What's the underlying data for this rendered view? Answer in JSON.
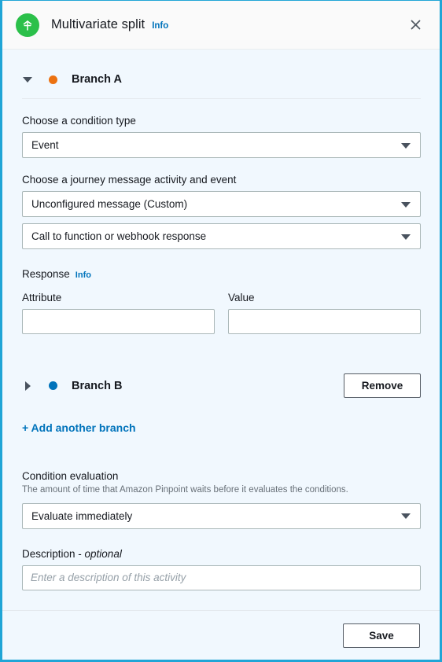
{
  "header": {
    "icon": "split-branch-icon",
    "icon_color": "#2bc04a",
    "title": "Multivariate split",
    "info_label": "Info",
    "close_icon": "close-icon"
  },
  "branch_a": {
    "label": "Branch A",
    "dot_color": "#ec7211",
    "expanded": true,
    "condition_type": {
      "label": "Choose a condition type",
      "value": "Event"
    },
    "journey_activity": {
      "label": "Choose a journey message activity and event",
      "activity_value": "Unconfigured message (Custom)",
      "event_value": "Call to function or webhook response"
    },
    "response": {
      "label": "Response",
      "info_label": "Info",
      "attribute_label": "Attribute",
      "attribute_value": "",
      "value_label": "Value",
      "value_value": ""
    }
  },
  "branch_b": {
    "label": "Branch B",
    "dot_color": "#0073bb",
    "expanded": false,
    "remove_label": "Remove"
  },
  "add_branch_label": "+ Add another branch",
  "condition_evaluation": {
    "label": "Condition evaluation",
    "hint": "The amount of time that Amazon Pinpoint waits before it evaluates the conditions.",
    "value": "Evaluate immediately"
  },
  "description": {
    "label": "Description - ",
    "optional_label": "optional",
    "placeholder": "Enter a description of this activity",
    "value": ""
  },
  "footer": {
    "save_label": "Save"
  }
}
